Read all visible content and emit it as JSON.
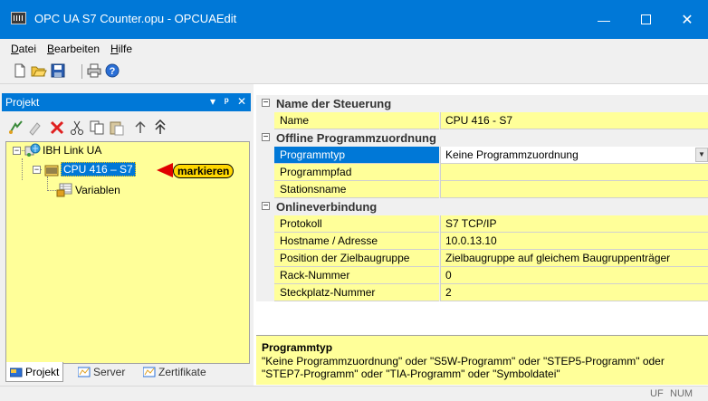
{
  "window": {
    "title": "OPC UA S7 Counter.opu - OPCUAEdit",
    "minimize_glyph": "—",
    "close_glyph": "✕"
  },
  "menu": [
    {
      "label": "Datei",
      "accel": "D",
      "rest": "atei"
    },
    {
      "label": "Bearbeiten",
      "accel": "B",
      "rest": "earbeiten"
    },
    {
      "label": "Hilfe",
      "accel": "H",
      "rest": "ilfe"
    }
  ],
  "toolbar": {
    "icons": [
      "new-file-icon",
      "open-folder-icon",
      "save-icon",
      "print-icon",
      "help-icon"
    ]
  },
  "project_panel": {
    "title": "Projekt",
    "dropdown_glyph": "▾",
    "pin_glyph": "ᵖ",
    "close_glyph": "✕",
    "tree_toolbar": [
      "new-connection-icon",
      "properties-icon",
      "delete-icon",
      "cut-icon",
      "copy-icon",
      "paste-icon",
      "move-up-icon",
      "move-top-icon"
    ],
    "tree": {
      "root": "IBH Link UA",
      "cpu": "CPU 416 – S7",
      "variables": "Variablen"
    },
    "callout": "markieren",
    "tabs": [
      "Projekt",
      "Server",
      "Zertifikate"
    ]
  },
  "properties": {
    "categories": [
      {
        "label": "Name der Steuerung",
        "rows": [
          {
            "name": "Name",
            "value": "CPU 416 - S7"
          }
        ]
      },
      {
        "label": "Offline Programmzuordnung",
        "rows": [
          {
            "name": "Programmtyp",
            "value": "Keine Programmzuordnung"
          },
          {
            "name": "Programmpfad",
            "value": ""
          },
          {
            "name": "Stationsname",
            "value": ""
          }
        ]
      },
      {
        "label": "Onlineverbindung",
        "rows": [
          {
            "name": "Protokoll",
            "value": "S7 TCP/IP"
          },
          {
            "name": "Hostname / Adresse",
            "value": "10.0.13.10"
          },
          {
            "name": "Position der Zielbaugruppe",
            "value": "Zielbaugruppe auf gleichem Baugruppenträger"
          },
          {
            "name": "Rack-Nummer",
            "value": "0"
          },
          {
            "name": "Steckplatz-Nummer",
            "value": "2"
          }
        ]
      }
    ],
    "collapse_glyph": "−"
  },
  "description": {
    "title": "Programmtyp",
    "text": "\"Keine Programmzuordnung\" oder \"S5W-Programm\" oder \"STEP5-Programm\" oder \"STEP7-Programm\" oder \"TIA-Programm\" oder \"Symboldatei\""
  },
  "status": {
    "uf": "UF",
    "num": "NUM"
  },
  "colors": {
    "accent": "#0078d7",
    "highlight": "#ffff99",
    "callout": "#ffd700",
    "arrow": "#e00000"
  }
}
